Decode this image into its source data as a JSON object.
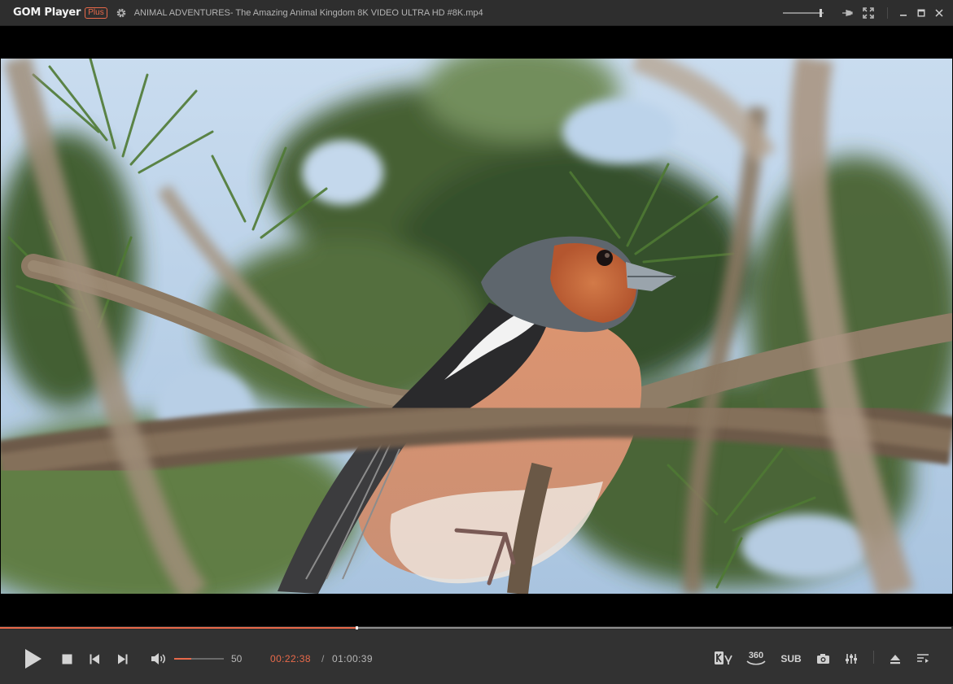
{
  "app": {
    "name": "GOM Player",
    "edition": "Plus",
    "file_title": "ANIMAL ADVENTURES- The Amazing Animal Kingdom 8K VIDEO ULTRA HD #8K.mp4"
  },
  "titlebar": {
    "icons": [
      "settings-gear-icon",
      "volume-mini-slider",
      "pin-icon",
      "fullscreen-icon",
      "minimize-icon",
      "maximize-icon",
      "close-icon"
    ]
  },
  "playback": {
    "current_time": "00:22:38",
    "separator": "/",
    "duration": "01:00:39",
    "progress_fraction": 0.373,
    "state": "paused"
  },
  "volume": {
    "value": "50",
    "fraction": 0.35
  },
  "controls": {
    "left_icons": [
      "play-icon",
      "stop-icon",
      "previous-icon",
      "next-icon",
      "speaker-icon"
    ],
    "kvr_icon": "kvr-icon",
    "vr360_label": "360",
    "subtitle_label": "SUB",
    "right_icons": [
      "screenshot-camera-icon",
      "equalizer-icon",
      "eject-icon",
      "playlist-icon"
    ]
  },
  "colors": {
    "accent": "#e8694a",
    "titlebar_bg": "#2e2e2e",
    "controlbar_bg": "#323232",
    "video_bg": "#000000"
  }
}
